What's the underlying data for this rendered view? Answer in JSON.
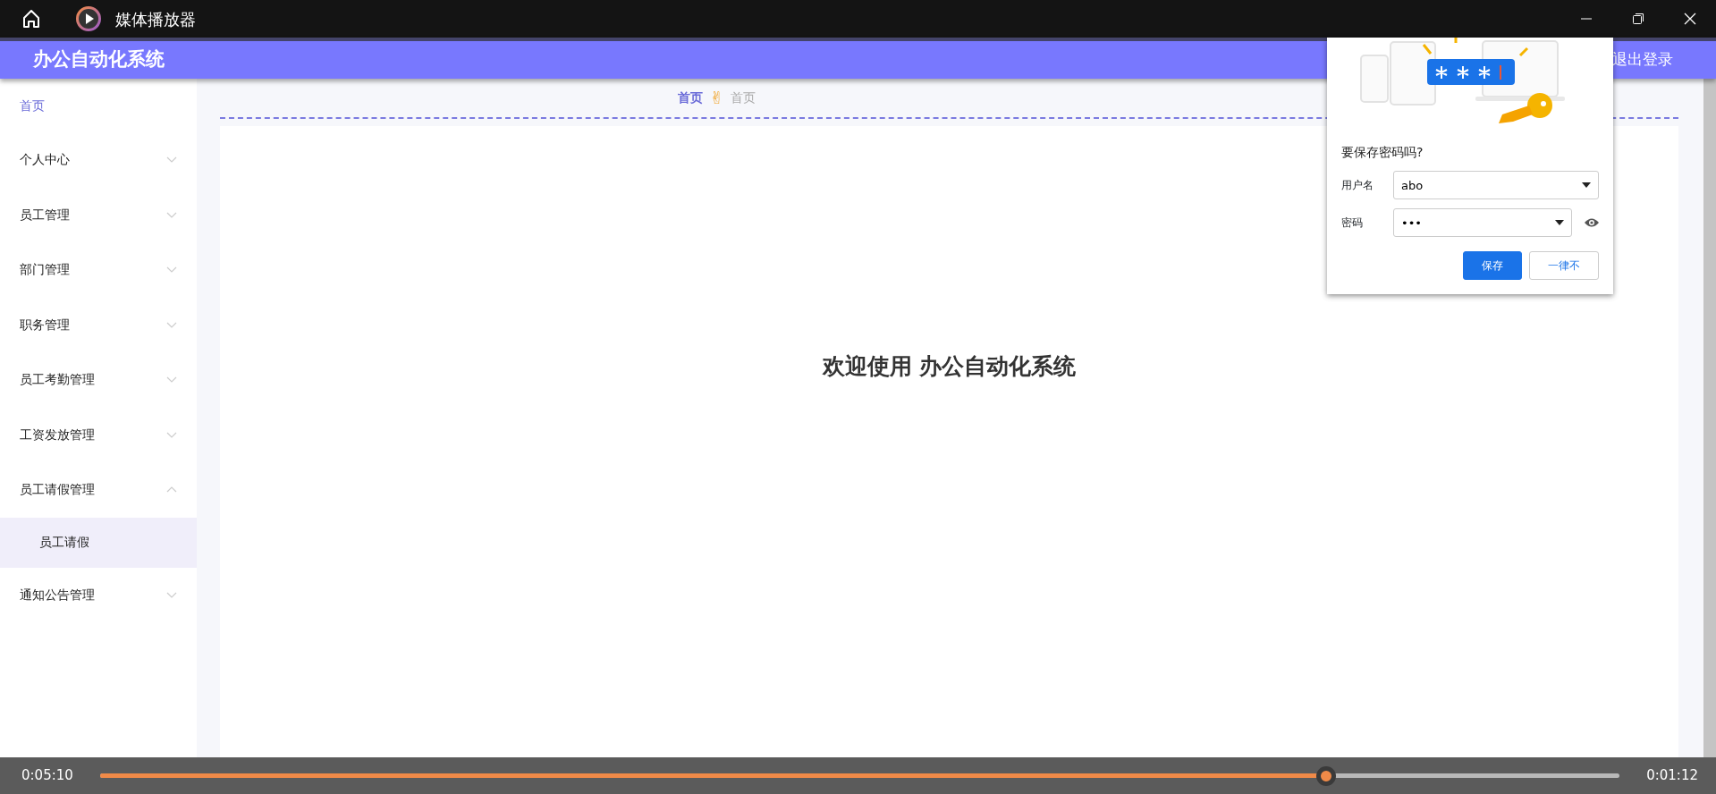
{
  "player": {
    "title": "媒体播放器",
    "position": "0:05:10",
    "remaining": "0:01:12",
    "progress": {
      "level": 0.807
    }
  },
  "app": {
    "title": "办公自动化系统",
    "logout": "退出登录",
    "sidebar": [
      {
        "kind": "link",
        "label": "首页",
        "selected": true
      },
      {
        "kind": "menu",
        "label": "个人中心",
        "selected": false,
        "expanded": false
      },
      {
        "kind": "menu",
        "label": "员工管理",
        "selected": false,
        "expanded": false
      },
      {
        "kind": "menu",
        "label": "部门管理",
        "selected": false,
        "expanded": false
      },
      {
        "kind": "menu",
        "label": "职务管理",
        "selected": false,
        "expanded": false
      },
      {
        "kind": "menu",
        "label": "员工考勤管理",
        "selected": false,
        "expanded": false
      },
      {
        "kind": "menu",
        "label": "工资发放管理",
        "selected": false,
        "expanded": false
      },
      {
        "kind": "menu",
        "label": "员工请假管理",
        "selected": false,
        "expanded": true,
        "children": [
          {
            "label": "员工请假",
            "selected": false
          }
        ]
      },
      {
        "kind": "menu",
        "label": "通知公告管理",
        "selected": false,
        "expanded": false
      }
    ],
    "breadcrumb": {
      "separator": "✌",
      "items": [
        {
          "label": "首页",
          "current": false
        },
        {
          "label": "首页",
          "current": true
        }
      ]
    },
    "welcome": "欢迎使用 办公自动化系统"
  },
  "password_popup": {
    "question": "要保存密码吗?",
    "username": {
      "label": "用户名",
      "value": "abo"
    },
    "password": {
      "label": "密码",
      "value": "•••"
    },
    "buttons": [
      {
        "label": "保存",
        "primary": true
      },
      {
        "label": "一律不",
        "primary": false
      }
    ]
  }
}
